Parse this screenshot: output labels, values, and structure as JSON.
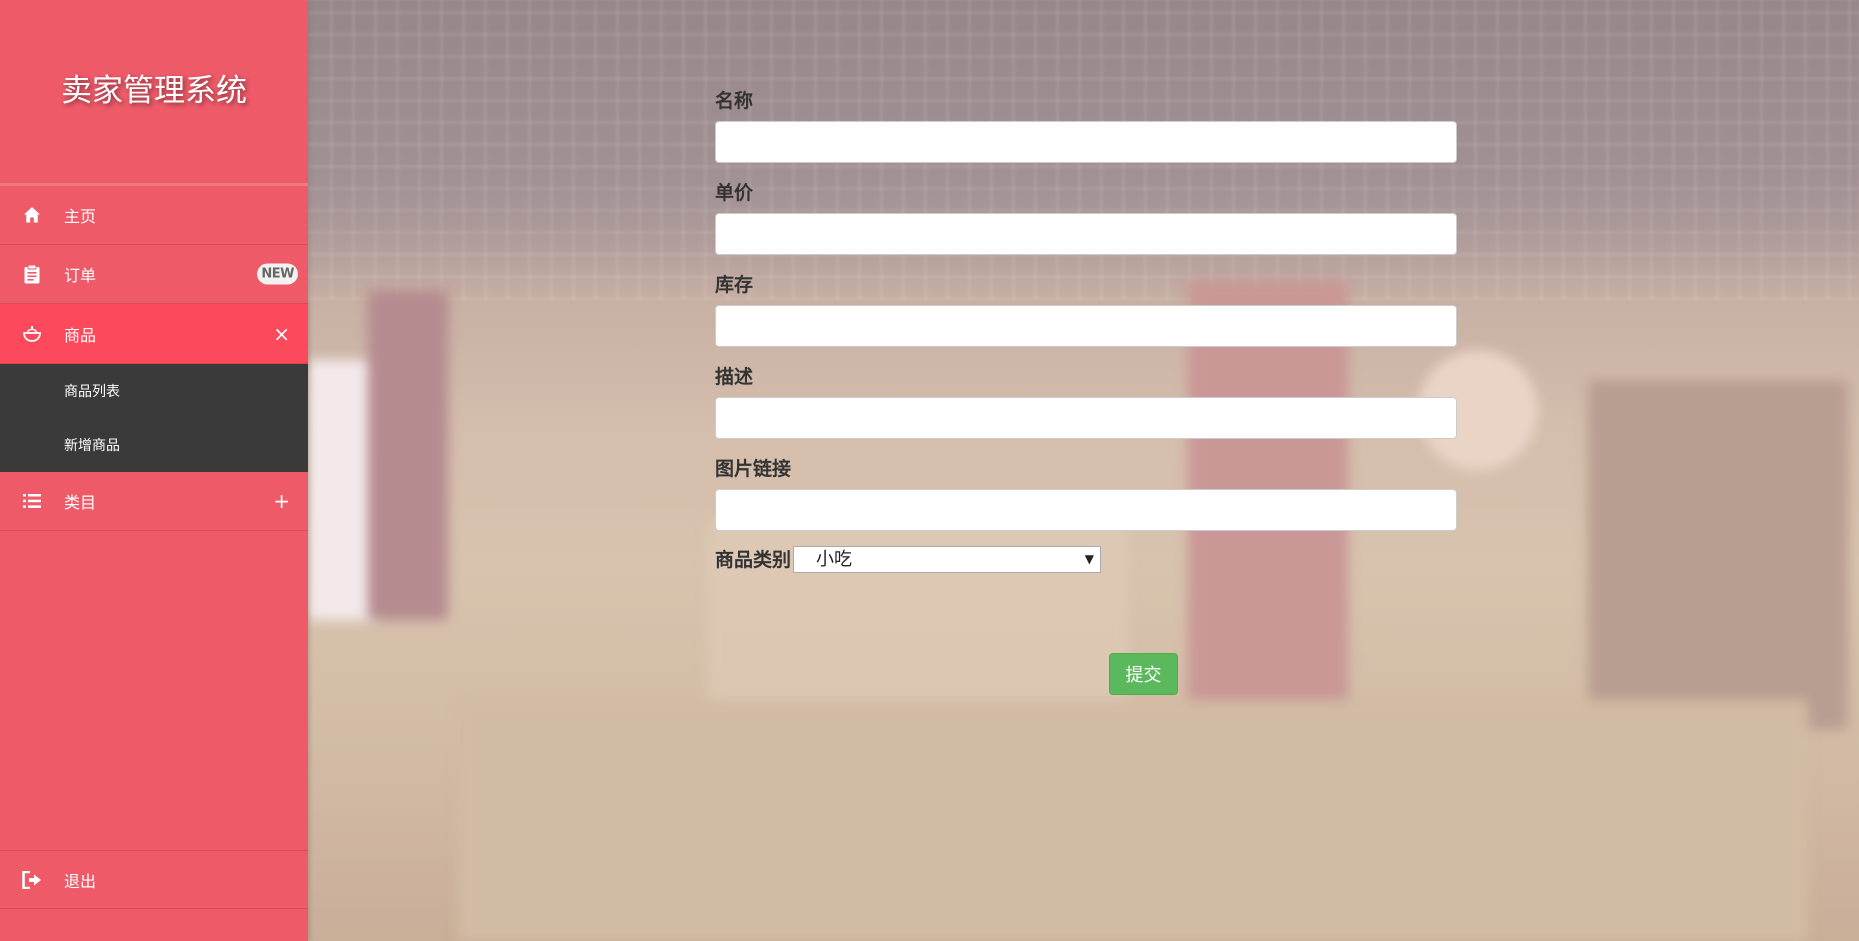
{
  "app": {
    "title": "卖家管理系统"
  },
  "sidebar": {
    "items": [
      {
        "label": "主页",
        "icon": "home-icon"
      },
      {
        "label": "订单",
        "icon": "clipboard-icon",
        "badge": "NEW"
      },
      {
        "label": "商品",
        "icon": "bowl-icon",
        "toggle": "×",
        "expanded": true
      },
      {
        "label": "类目",
        "icon": "list-icon",
        "toggle": "+"
      }
    ],
    "submenu": [
      {
        "label": "商品列表"
      },
      {
        "label": "新增商品"
      }
    ],
    "logout": {
      "label": "退出",
      "icon": "logout-icon"
    }
  },
  "form": {
    "fields": [
      {
        "label": "名称",
        "value": ""
      },
      {
        "label": "单价",
        "value": ""
      },
      {
        "label": "库存",
        "value": ""
      },
      {
        "label": "描述",
        "value": ""
      },
      {
        "label": "图片链接",
        "value": ""
      }
    ],
    "category": {
      "label": "商品类别",
      "selected": "小吃"
    },
    "submit_label": "提交"
  },
  "colors": {
    "sidebar_bg": "#ee5a68",
    "active_item_bg": "#fc4a5c",
    "submenu_bg": "#3a3a3a",
    "submit_bg": "#5cb85c"
  }
}
